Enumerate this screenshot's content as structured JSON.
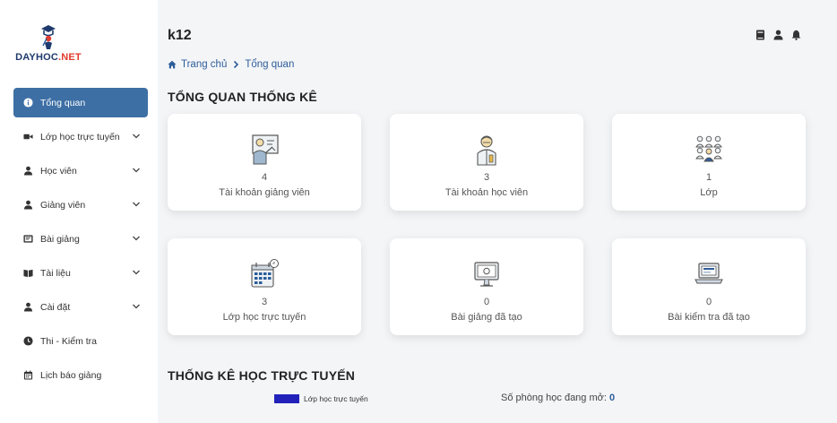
{
  "brand": {
    "logo_main": "DAYHOC",
    "logo_accent": ".NET"
  },
  "sidebar": {
    "items": [
      {
        "label": "Tổng quan",
        "icon": "info-icon",
        "active": true,
        "has_chevron": false
      },
      {
        "label": "Lớp học trực tuyến",
        "icon": "video-camera-icon",
        "active": false,
        "has_chevron": true
      },
      {
        "label": "Học viên",
        "icon": "user-icon",
        "active": false,
        "has_chevron": true
      },
      {
        "label": "Giảng viên",
        "icon": "user-icon",
        "active": false,
        "has_chevron": true
      },
      {
        "label": "Bài giảng",
        "icon": "slides-icon",
        "active": false,
        "has_chevron": true
      },
      {
        "label": "Tài liệu",
        "icon": "book-open-icon",
        "active": false,
        "has_chevron": true
      },
      {
        "label": "Cài đặt",
        "icon": "user-gear-icon",
        "active": false,
        "has_chevron": true
      },
      {
        "label": "Thi - Kiểm tra",
        "icon": "clock-icon",
        "active": false,
        "has_chevron": false
      },
      {
        "label": "Lịch báo giảng",
        "icon": "calendar-icon",
        "active": false,
        "has_chevron": false
      }
    ]
  },
  "header": {
    "title": "k12",
    "breadcrumb": {
      "home": "Trang chủ",
      "current": "Tổng quan"
    },
    "icons": [
      "book-icon",
      "user-icon",
      "bell-icon"
    ]
  },
  "overview": {
    "title": "TỔNG QUAN THỐNG KÊ",
    "cards": [
      {
        "value": "4",
        "label": "Tài khoản giảng viên",
        "icon": "teacher-board-icon"
      },
      {
        "value": "3",
        "label": "Tài khoản học viên",
        "icon": "student-icon"
      },
      {
        "value": "1",
        "label": "Lớp",
        "icon": "classroom-group-icon"
      },
      {
        "value": "3",
        "label": "Lớp học trực tuyến",
        "icon": "calendar-grid-icon"
      },
      {
        "value": "0",
        "label": "Bài giảng đã tạo",
        "icon": "monitor-icon"
      },
      {
        "value": "0",
        "label": "Bài kiểm tra đã tạo",
        "icon": "laptop-icon"
      }
    ]
  },
  "online": {
    "title": "THỐNG KÊ HỌC TRỰC TUYẾN",
    "legend_label": "Lớp học trực tuyến",
    "legend_color": "#2222bb",
    "rooms_label": "Số phòng học đang mở:",
    "rooms_value": "0"
  },
  "colors": {
    "active_nav": "#3d6fa5",
    "link": "#2d5d9a",
    "logo_accent": "#e23b2e"
  }
}
